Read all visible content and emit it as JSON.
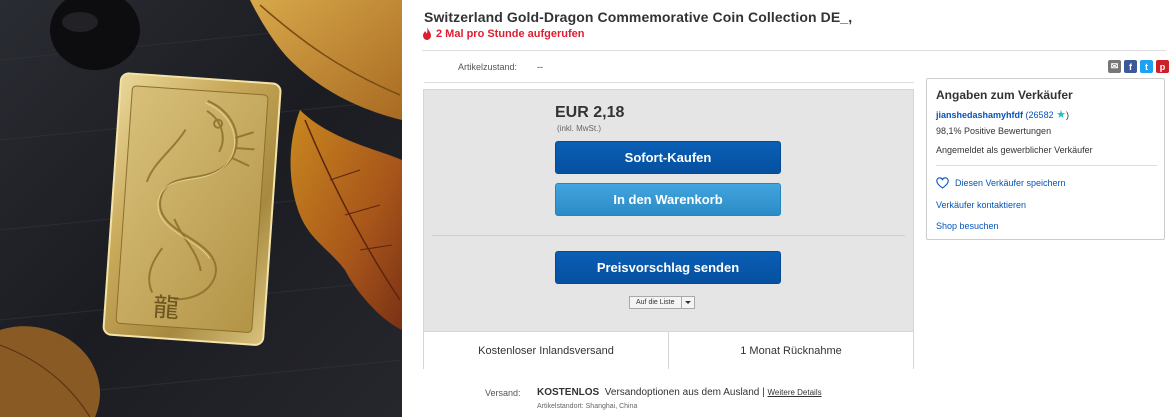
{
  "item": {
    "title": "Switzerland Gold-Dragon Commemorative Coin Collection DE_,",
    "watchers": "2 Mal pro Stunde aufgerufen",
    "condition_label": "Artikelzustand:",
    "condition_value": "--"
  },
  "share_icons": [
    "mail-icon",
    "facebook-icon",
    "twitter-icon",
    "pinterest-icon"
  ],
  "buybox": {
    "price": "EUR 2,18",
    "vat": "(inkl. MwSt.)",
    "buy_now": "Sofort-Kaufen",
    "add_to_cart": "In den Warenkorb",
    "make_offer": "Preisvorschlag senden",
    "watchlist": "Auf die Liste",
    "shipping_free": "Kostenloser Inlandsversand",
    "returns": "1 Monat Rücknahme"
  },
  "shipping": {
    "label": "Versand:",
    "value": "KOSTENLOS",
    "options": "Versandoptionen aus dem Ausland |",
    "details_link": "Weitere Details",
    "location": "Artikelstandort:  Shanghai, China"
  },
  "seller": {
    "heading": "Angaben zum Verkäufer",
    "name": "jianshedashamyhfdf",
    "feedback_open": "(",
    "feedback_score": "26582",
    "feedback_close": ")",
    "positive": "98,1% Positive Bewertungen",
    "business": "Angemeldet als gewerblicher Verkäufer",
    "save_seller": "Diesen Verkäufer speichern",
    "contact": "Verkäufer kontaktieren",
    "shop": "Shop besuchen"
  },
  "photo": {
    "bar_glyph": "龍"
  },
  "colors": {
    "buy_button": "#0654ba",
    "cart_button": "#3498db",
    "link": "#0654ba",
    "watchers": "#dd1e31",
    "feedback_star": "#19c2bf"
  }
}
